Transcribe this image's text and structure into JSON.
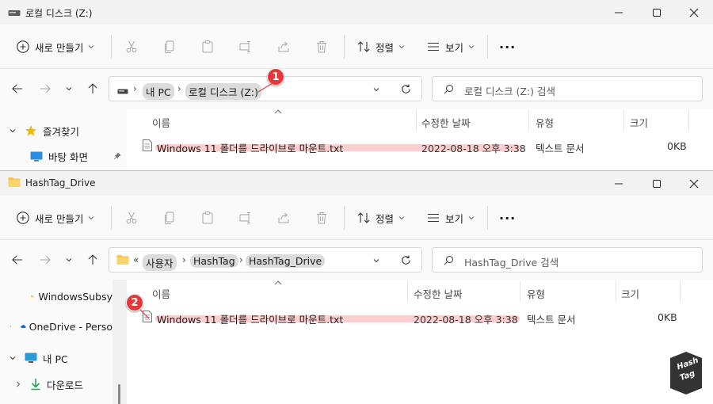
{
  "window1": {
    "title": "로컬 디스크 (Z:)",
    "toolbar": {
      "new_label": "새로 만들기",
      "sort_label": "정렬",
      "view_label": "보기",
      "more_label": "···"
    },
    "address": {
      "crumbs": [
        "내 PC",
        "로컬 디스크 (Z:)"
      ]
    },
    "search_placeholder": "로컬 디스크 (Z:) 검색",
    "sidebar": [
      {
        "label": "즐겨찾기",
        "icon": "star-icon"
      },
      {
        "label": "바탕 화면",
        "icon": "desktop-icon"
      }
    ],
    "columns": [
      "이름",
      "수정한 날짜",
      "유형",
      "크기"
    ],
    "rows": [
      {
        "name": "Windows 11 폴더를 드라이브로 마운트.txt",
        "date": "2022-08-18 오후 3:38",
        "type": "텍스트 문서",
        "size": "0KB"
      }
    ],
    "badge": "1"
  },
  "window2": {
    "title": "HashTag_Drive",
    "toolbar": {
      "new_label": "새로 만들기",
      "sort_label": "정렬",
      "view_label": "보기",
      "more_label": "···"
    },
    "address": {
      "prefix": "«",
      "crumbs": [
        "사용자",
        "HashTag",
        "HashTag_Drive"
      ]
    },
    "search_placeholder": "HashTag_Drive 검색",
    "sidebar": [
      {
        "label": "WindowsSubsy",
        "icon": "folder-icon"
      },
      {
        "label": "OneDrive - Perso",
        "icon": "onedrive-icon"
      },
      {
        "label": "내 PC",
        "icon": "pc-icon"
      },
      {
        "label": "다운로드",
        "icon": "download-icon"
      }
    ],
    "columns": [
      "이름",
      "수정한 날짜",
      "유형",
      "크기"
    ],
    "rows": [
      {
        "name": "Windows 11 폴더를 드라이브로 마운트.txt",
        "date": "2022-08-18 오후 3:38",
        "type": "텍스트 문서",
        "size": "0KB"
      }
    ],
    "badge": "2"
  },
  "watermark": {
    "line1": "Hash",
    "line2": "Tag"
  },
  "colors": {
    "accent_badge": "#e5383b",
    "highlight": "#f57878",
    "folder": "#f6c24d",
    "star": "#f2b705",
    "onedrive": "#0f6cbd",
    "download": "#23a55a"
  }
}
